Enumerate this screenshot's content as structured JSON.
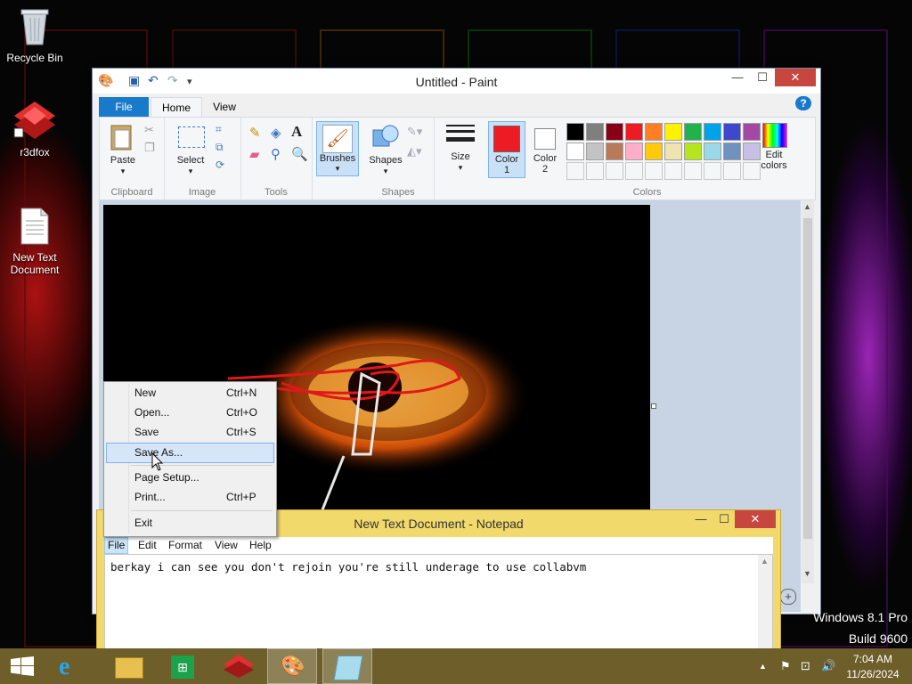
{
  "desktop": {
    "icons": [
      {
        "label": "Recycle Bin"
      },
      {
        "label": "r3dfox"
      },
      {
        "label": "New Text\nDocument"
      }
    ],
    "watermark": {
      "line1": "Windows 8.1 Pro",
      "line2": "Build 9600"
    }
  },
  "paint": {
    "title": "Untitled - Paint",
    "tabs": [
      "File",
      "Home",
      "View"
    ],
    "groups": {
      "clipboard": {
        "label": "Clipboard",
        "paste": "Paste"
      },
      "image": {
        "label": "Image",
        "select": "Select"
      },
      "tools": {
        "label": "Tools"
      },
      "brushes": "Brushes",
      "shapes": {
        "label": "Shapes",
        "shapes_btn": "Shapes"
      },
      "size": "Size",
      "colors": {
        "label": "Colors",
        "color1": "Color\n1",
        "color2": "Color\n2",
        "edit": "Edit\ncolors"
      }
    },
    "color1_value": "#ed1c24",
    "color2_value": "#ffffff",
    "palette_row1": [
      "#000000",
      "#7f7f7f",
      "#880015",
      "#ed1c24",
      "#ff7f27",
      "#fff200",
      "#22b14c",
      "#00a2e8",
      "#3f48cc",
      "#a349a4"
    ],
    "palette_row2": [
      "#ffffff",
      "#c3c3c3",
      "#b97a57",
      "#ffaec9",
      "#ffc90e",
      "#efe4b0",
      "#b5e61d",
      "#99d9ea",
      "#7092be",
      "#c8bfe7"
    ]
  },
  "file_menu": {
    "items": [
      {
        "label": "New",
        "shortcut": "Ctrl+N"
      },
      {
        "label": "Open...",
        "shortcut": "Ctrl+O"
      },
      {
        "label": "Save",
        "shortcut": "Ctrl+S"
      },
      {
        "label": "Save As...",
        "shortcut": ""
      },
      {
        "label": "Page Setup...",
        "shortcut": ""
      },
      {
        "label": "Print...",
        "shortcut": "Ctrl+P"
      },
      {
        "label": "Exit",
        "shortcut": ""
      }
    ]
  },
  "notepad": {
    "title": "New Text Document - Notepad",
    "menu": [
      "File",
      "Edit",
      "Format",
      "View",
      "Help"
    ],
    "content": "berkay i can see you don't rejoin you're still underage to use collabvm"
  },
  "taskbar": {
    "time": "7:04 AM",
    "date": "11/26/2024"
  }
}
